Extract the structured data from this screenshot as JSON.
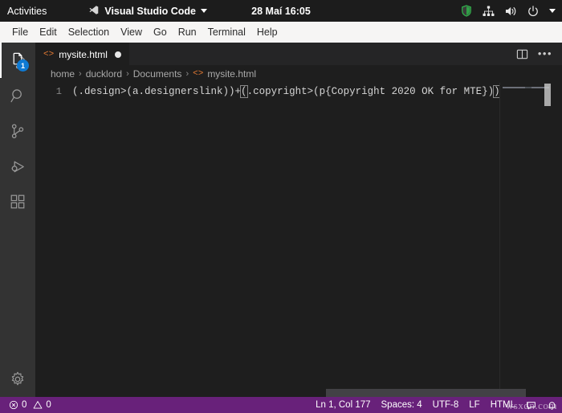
{
  "gnome": {
    "activities": "Activities",
    "app_name": "Visual Studio Code",
    "app_icon": "vscode-icon",
    "clock": "28 Maí  16:05",
    "tray": {
      "shield_icon": "shield-icon",
      "network_icon": "network-icon",
      "volume_icon": "volume-icon",
      "power_icon": "power-icon",
      "caret_icon": "chevron-down-icon"
    }
  },
  "menubar": {
    "items": [
      {
        "label": "File"
      },
      {
        "label": "Edit"
      },
      {
        "label": "Selection"
      },
      {
        "label": "View"
      },
      {
        "label": "Go"
      },
      {
        "label": "Run"
      },
      {
        "label": "Terminal"
      },
      {
        "label": "Help"
      }
    ]
  },
  "activitybar": {
    "items": [
      {
        "name": "explorer",
        "icon": "files-icon",
        "badge": "1",
        "active": true
      },
      {
        "name": "search",
        "icon": "search-icon",
        "badge": "",
        "active": false
      },
      {
        "name": "source-control",
        "icon": "source-control-icon",
        "badge": "",
        "active": false
      },
      {
        "name": "run-debug",
        "icon": "run-debug-icon",
        "badge": "",
        "active": false
      },
      {
        "name": "extensions",
        "icon": "extensions-icon",
        "badge": "",
        "active": false
      }
    ],
    "manage": {
      "name": "manage",
      "icon": "gear-icon"
    }
  },
  "editor": {
    "tab": {
      "file_icon": "<>",
      "label": "mysite.html",
      "dirty": true
    },
    "actions": {
      "split_icon": "split-editor-icon",
      "more_icon": "more-actions-icon",
      "more_label": "•••"
    },
    "breadcrumbs": [
      {
        "label": "home"
      },
      {
        "label": "ducklord"
      },
      {
        "label": "Documents"
      }
    ],
    "breadcrumb_separator": "›",
    "breadcrumb_file": {
      "icon": "<>",
      "label": "mysite.html"
    },
    "line_number": "1",
    "code": {
      "part_a": "(.design>(a.designerslink))+",
      "bracket_open": "(",
      "part_b": ".copyright>(p{Copyright 2020 OK for MTE})",
      "bracket_close": ")"
    }
  },
  "statusbar": {
    "error_icon": "error-icon",
    "error_count": "0",
    "warning_icon": "warning-icon",
    "warning_count": "0",
    "cursor_position": "Ln 1, Col 177",
    "indentation": "Spaces: 4",
    "encoding": "UTF-8",
    "eol": "LF",
    "language": "HTML",
    "bell_icon": "bell-icon",
    "feedback_icon": "feedback-icon",
    "watermark": "wsxdn.com"
  },
  "colors": {
    "statusbar_bg": "#68217a",
    "activitybar_bg": "#333333",
    "editor_bg": "#1e1e1e",
    "tabbar_bg": "#252526",
    "menubar_bg": "#f6f5f4",
    "badge_bg": "#0e7ad4",
    "html_icon": "#e37933"
  }
}
